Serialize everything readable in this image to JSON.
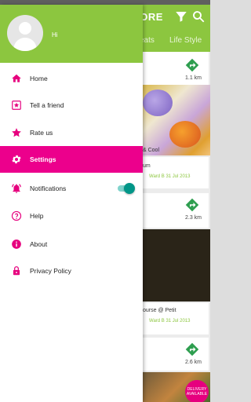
{
  "drawer": {
    "greeting": "Hi",
    "items": [
      {
        "label": "Home",
        "icon": "home-icon"
      },
      {
        "label": "Tell a friend",
        "icon": "star-box-icon"
      },
      {
        "label": "Rate us",
        "icon": "star-icon"
      },
      {
        "label": "Settings",
        "icon": "gear-icon",
        "active": true
      },
      {
        "label": "Notifications",
        "icon": "alarm-bell-icon",
        "toggle_on": true
      },
      {
        "label": "Help",
        "icon": "help-circle-icon"
      },
      {
        "label": "About",
        "icon": "info-icon"
      },
      {
        "label": "Privacy Policy",
        "icon": "lock-icon"
      }
    ]
  },
  "background": {
    "title": "TORE",
    "tabs": [
      "eats",
      "Life Style"
    ],
    "cards": [
      {
        "distance": "1.1 km"
      },
      {
        "distance": "2.3 km"
      },
      {
        "distance": "2.6 km"
      }
    ],
    "snippets": [
      "& Cool",
      "um",
      "Ward B 31 Jul 2013",
      "ourse @ Petit",
      "Ward B 31 Jul 2013"
    ],
    "badge": "DELIVERY AVAILABLE"
  },
  "colors": {
    "header_green": "#8cc63f",
    "accent_magenta": "#ec008c",
    "toggle_teal": "#009688"
  }
}
